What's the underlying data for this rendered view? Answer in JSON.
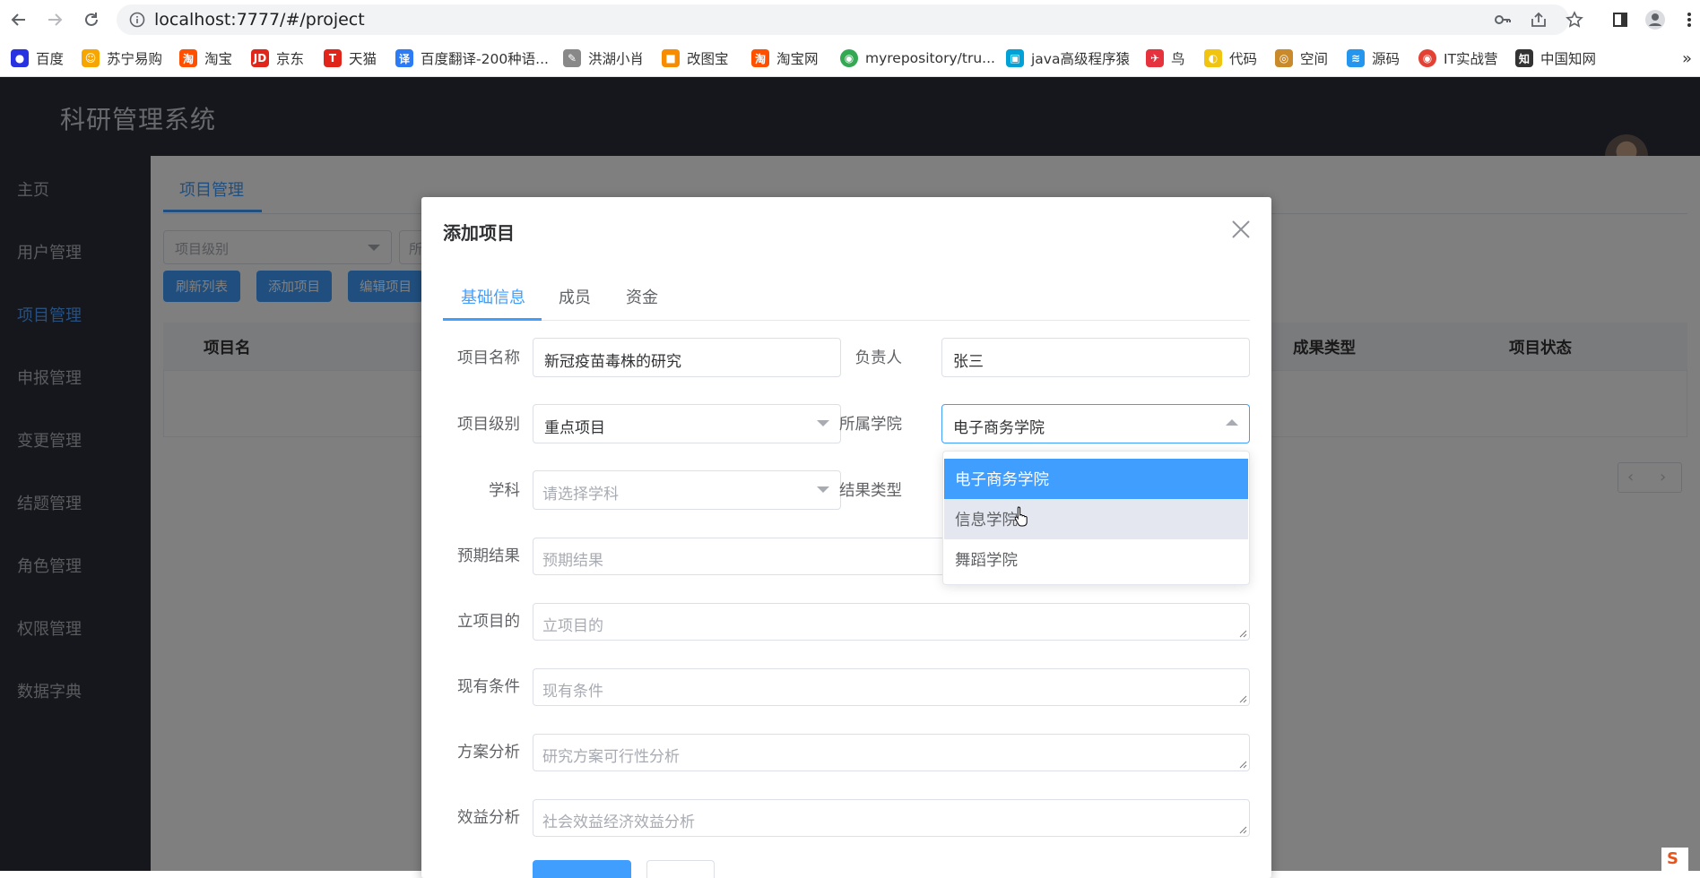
{
  "browser": {
    "url": "localhost:7777/#/project",
    "bookmarks": [
      {
        "label": "百度",
        "icon": "baidu-paw-icon",
        "color": "#2932e1"
      },
      {
        "label": "苏宁易购",
        "icon": "suning-lion-icon",
        "color": "#f7a600"
      },
      {
        "label": "淘宝",
        "icon": "taobao-icon",
        "color": "#ff5000"
      },
      {
        "label": "京东",
        "icon": "jd-icon",
        "color": "#e1251b"
      },
      {
        "label": "天猫",
        "icon": "tmall-icon",
        "color": "#e1251b"
      },
      {
        "label": "百度翻译-200种语...",
        "icon": "baidu-translate-icon",
        "color": "#2b7bf6"
      },
      {
        "label": "洪湖小肖",
        "icon": "feather-icon",
        "color": "#555555"
      },
      {
        "label": "改图宝",
        "icon": "gaitubao-icon",
        "color": "#f78c00"
      },
      {
        "label": "淘宝网",
        "icon": "taobao-net-icon",
        "color": "#ff5000"
      },
      {
        "label": "myrepository/tru...",
        "icon": "chrome-logo-icon",
        "color": "#34a853"
      },
      {
        "label": "java高级程序猿",
        "icon": "bilibili-icon",
        "color": "#00a1d6"
      },
      {
        "label": "鸟",
        "icon": "bird-icon",
        "color": "#e5323d"
      },
      {
        "label": "代码",
        "icon": "code-leaf-icon",
        "color": "#f1c40f"
      },
      {
        "label": "空间",
        "icon": "space-icon",
        "color": "#c98a2b"
      },
      {
        "label": "源码",
        "icon": "docker-whale-icon",
        "color": "#2496ed"
      },
      {
        "label": "IT实战营",
        "icon": "chrome-red-icon",
        "color": "#e34133"
      },
      {
        "label": "中国知网",
        "icon": "cnki-icon",
        "color": "#333333"
      }
    ],
    "more": "»"
  },
  "app": {
    "title": "科研管理系统",
    "sidebar": [
      {
        "label": "主页",
        "active": false
      },
      {
        "label": "用户管理",
        "active": false
      },
      {
        "label": "项目管理",
        "active": true
      },
      {
        "label": "申报管理",
        "active": false
      },
      {
        "label": "变更管理",
        "active": false
      },
      {
        "label": "结题管理",
        "active": false
      },
      {
        "label": "角色管理",
        "active": false
      },
      {
        "label": "权限管理",
        "active": false
      },
      {
        "label": "数据字典",
        "active": false
      }
    ],
    "main_tab": "项目管理",
    "filter_placeholder": "项目级别",
    "filter2_text": "所",
    "buttons": [
      "刷新列表",
      "添加项目",
      "编辑项目"
    ],
    "table_headers": {
      "name": "项目名",
      "result_type": "成果类型",
      "status": "项目状态"
    }
  },
  "dialog": {
    "title": "添加项目",
    "tabs": [
      "基础信息",
      "成员",
      "资金"
    ],
    "active_tab": 0,
    "fields": {
      "project_name": {
        "label": "项目名称",
        "value": "新冠疫苗毒株的研究"
      },
      "leader": {
        "label": "负责人",
        "value": "张三"
      },
      "level": {
        "label": "项目级别",
        "value": "重点项目"
      },
      "college": {
        "label": "所属学院",
        "value": "电子商务学院"
      },
      "subject": {
        "label": "学科",
        "placeholder": "请选择学科"
      },
      "result_type": {
        "label": "结果类型"
      },
      "expected_result": {
        "label": "预期结果",
        "placeholder": "预期结果"
      },
      "purpose": {
        "label": "立项目的",
        "placeholder": "立项目的"
      },
      "conditions": {
        "label": "现有条件",
        "placeholder": "现有条件"
      },
      "plan_analysis": {
        "label": "方案分析",
        "placeholder": "研究方案可行性分析"
      },
      "benefit_analysis": {
        "label": "效益分析",
        "placeholder": "社会效益经济效益分析"
      }
    },
    "college_options": [
      {
        "label": "电子商务学院",
        "state": "selected"
      },
      {
        "label": "信息学院",
        "state": "hover"
      },
      {
        "label": "舞蹈学院",
        "state": "normal"
      }
    ]
  },
  "colors": {
    "primary": "#409eff",
    "sidebar_bg": "#2a2f3a",
    "overlay": "rgba(0,0,0,0.5)"
  }
}
